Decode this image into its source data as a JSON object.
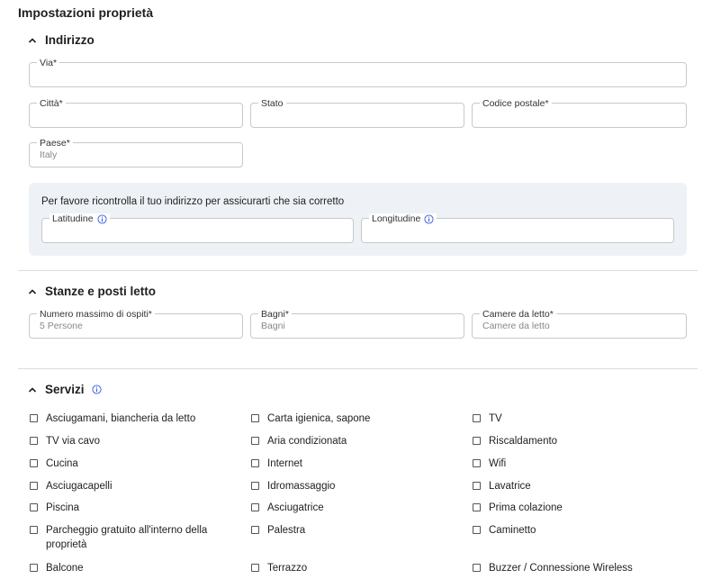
{
  "page_title": "Impostazioni proprietà",
  "address": {
    "title": "Indirizzo",
    "street_label": "Via*",
    "city_label": "Città*",
    "state_label": "Stato",
    "postal_label": "Codice postale*",
    "country_label": "Paese*",
    "country_value": "Italy",
    "verify_text": "Per favore ricontrolla il tuo indirizzo per assicurarti che sia corretto",
    "latitude_label": "Latitudine",
    "longitude_label": "Longitudine"
  },
  "rooms": {
    "title": "Stanze e posti letto",
    "guests_label": "Numero massimo di ospiti*",
    "guests_value": "5 Persone",
    "baths_label": "Bagni*",
    "baths_value": "Bagni",
    "bedrooms_label": "Camere da letto*",
    "bedrooms_value": "Camere da letto"
  },
  "services": {
    "title": "Servizi",
    "col1": [
      "Asciugamani, biancheria da letto",
      "TV via cavo",
      "Cucina",
      "Asciugacapelli",
      "Piscina",
      "Parcheggio gratuito all'interno della proprietà",
      "Balcone"
    ],
    "col2": [
      "Carta igienica, sapone",
      "Aria condizionata",
      "Internet",
      "Idromassaggio",
      "Asciugatrice",
      "Palestra",
      "Terrazzo"
    ],
    "col3": [
      "TV",
      "Riscaldamento",
      "Wifi",
      "Lavatrice",
      "Prima colazione",
      "Caminetto",
      "Buzzer / Connessione Wireless"
    ]
  },
  "colors": {
    "info_icon": "#3b5bdb",
    "verify_bg": "#eef1f5",
    "border": "#c9c9c9"
  },
  "icons": {
    "collapse": "chevron-up-icon",
    "info": "info-icon",
    "checkbox": "checkbox-icon"
  }
}
